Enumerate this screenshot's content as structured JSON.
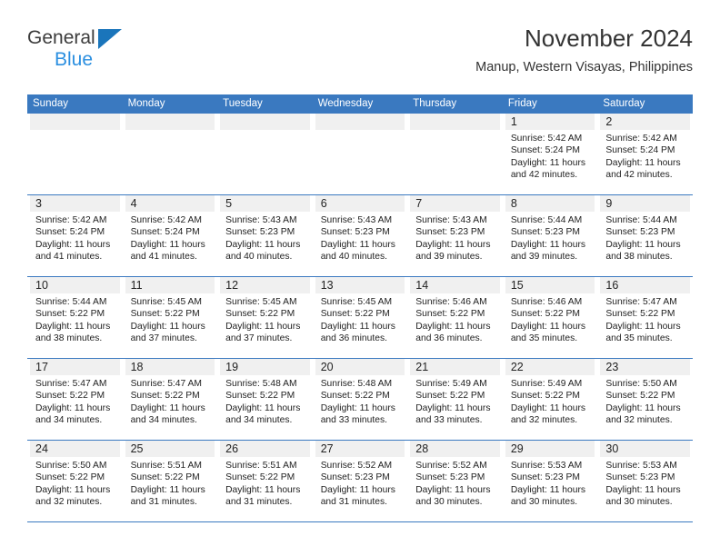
{
  "brand": {
    "name_top": "General",
    "name_bottom": "Blue",
    "color_dark": "#3c3c3c",
    "color_blue": "#2b8fe0",
    "triangle_color": "#1a75bb"
  },
  "header": {
    "title": "November 2024",
    "subtitle": "Manup, Western Visayas, Philippines",
    "accent_color": "#3a79c0",
    "daynum_bg": "#f0f0f0"
  },
  "weekday_headers": [
    "Sunday",
    "Monday",
    "Tuesday",
    "Wednesday",
    "Thursday",
    "Friday",
    "Saturday"
  ],
  "labels": {
    "sunrise_prefix": "Sunrise:",
    "sunset_prefix": "Sunset:",
    "daylight_prefix": "Daylight:"
  },
  "weeks": [
    [
      {
        "day": "",
        "empty": true
      },
      {
        "day": "",
        "empty": true
      },
      {
        "day": "",
        "empty": true
      },
      {
        "day": "",
        "empty": true
      },
      {
        "day": "",
        "empty": true
      },
      {
        "day": "1",
        "sunrise": "Sunrise: 5:42 AM",
        "sunset": "Sunset: 5:24 PM",
        "daylight_l1": "Daylight: 11 hours",
        "daylight_l2": "and 42 minutes."
      },
      {
        "day": "2",
        "sunrise": "Sunrise: 5:42 AM",
        "sunset": "Sunset: 5:24 PM",
        "daylight_l1": "Daylight: 11 hours",
        "daylight_l2": "and 42 minutes."
      }
    ],
    [
      {
        "day": "3",
        "sunrise": "Sunrise: 5:42 AM",
        "sunset": "Sunset: 5:24 PM",
        "daylight_l1": "Daylight: 11 hours",
        "daylight_l2": "and 41 minutes."
      },
      {
        "day": "4",
        "sunrise": "Sunrise: 5:42 AM",
        "sunset": "Sunset: 5:24 PM",
        "daylight_l1": "Daylight: 11 hours",
        "daylight_l2": "and 41 minutes."
      },
      {
        "day": "5",
        "sunrise": "Sunrise: 5:43 AM",
        "sunset": "Sunset: 5:23 PM",
        "daylight_l1": "Daylight: 11 hours",
        "daylight_l2": "and 40 minutes."
      },
      {
        "day": "6",
        "sunrise": "Sunrise: 5:43 AM",
        "sunset": "Sunset: 5:23 PM",
        "daylight_l1": "Daylight: 11 hours",
        "daylight_l2": "and 40 minutes."
      },
      {
        "day": "7",
        "sunrise": "Sunrise: 5:43 AM",
        "sunset": "Sunset: 5:23 PM",
        "daylight_l1": "Daylight: 11 hours",
        "daylight_l2": "and 39 minutes."
      },
      {
        "day": "8",
        "sunrise": "Sunrise: 5:44 AM",
        "sunset": "Sunset: 5:23 PM",
        "daylight_l1": "Daylight: 11 hours",
        "daylight_l2": "and 39 minutes."
      },
      {
        "day": "9",
        "sunrise": "Sunrise: 5:44 AM",
        "sunset": "Sunset: 5:23 PM",
        "daylight_l1": "Daylight: 11 hours",
        "daylight_l2": "and 38 minutes."
      }
    ],
    [
      {
        "day": "10",
        "sunrise": "Sunrise: 5:44 AM",
        "sunset": "Sunset: 5:22 PM",
        "daylight_l1": "Daylight: 11 hours",
        "daylight_l2": "and 38 minutes."
      },
      {
        "day": "11",
        "sunrise": "Sunrise: 5:45 AM",
        "sunset": "Sunset: 5:22 PM",
        "daylight_l1": "Daylight: 11 hours",
        "daylight_l2": "and 37 minutes."
      },
      {
        "day": "12",
        "sunrise": "Sunrise: 5:45 AM",
        "sunset": "Sunset: 5:22 PM",
        "daylight_l1": "Daylight: 11 hours",
        "daylight_l2": "and 37 minutes."
      },
      {
        "day": "13",
        "sunrise": "Sunrise: 5:45 AM",
        "sunset": "Sunset: 5:22 PM",
        "daylight_l1": "Daylight: 11 hours",
        "daylight_l2": "and 36 minutes."
      },
      {
        "day": "14",
        "sunrise": "Sunrise: 5:46 AM",
        "sunset": "Sunset: 5:22 PM",
        "daylight_l1": "Daylight: 11 hours",
        "daylight_l2": "and 36 minutes."
      },
      {
        "day": "15",
        "sunrise": "Sunrise: 5:46 AM",
        "sunset": "Sunset: 5:22 PM",
        "daylight_l1": "Daylight: 11 hours",
        "daylight_l2": "and 35 minutes."
      },
      {
        "day": "16",
        "sunrise": "Sunrise: 5:47 AM",
        "sunset": "Sunset: 5:22 PM",
        "daylight_l1": "Daylight: 11 hours",
        "daylight_l2": "and 35 minutes."
      }
    ],
    [
      {
        "day": "17",
        "sunrise": "Sunrise: 5:47 AM",
        "sunset": "Sunset: 5:22 PM",
        "daylight_l1": "Daylight: 11 hours",
        "daylight_l2": "and 34 minutes."
      },
      {
        "day": "18",
        "sunrise": "Sunrise: 5:47 AM",
        "sunset": "Sunset: 5:22 PM",
        "daylight_l1": "Daylight: 11 hours",
        "daylight_l2": "and 34 minutes."
      },
      {
        "day": "19",
        "sunrise": "Sunrise: 5:48 AM",
        "sunset": "Sunset: 5:22 PM",
        "daylight_l1": "Daylight: 11 hours",
        "daylight_l2": "and 34 minutes."
      },
      {
        "day": "20",
        "sunrise": "Sunrise: 5:48 AM",
        "sunset": "Sunset: 5:22 PM",
        "daylight_l1": "Daylight: 11 hours",
        "daylight_l2": "and 33 minutes."
      },
      {
        "day": "21",
        "sunrise": "Sunrise: 5:49 AM",
        "sunset": "Sunset: 5:22 PM",
        "daylight_l1": "Daylight: 11 hours",
        "daylight_l2": "and 33 minutes."
      },
      {
        "day": "22",
        "sunrise": "Sunrise: 5:49 AM",
        "sunset": "Sunset: 5:22 PM",
        "daylight_l1": "Daylight: 11 hours",
        "daylight_l2": "and 32 minutes."
      },
      {
        "day": "23",
        "sunrise": "Sunrise: 5:50 AM",
        "sunset": "Sunset: 5:22 PM",
        "daylight_l1": "Daylight: 11 hours",
        "daylight_l2": "and 32 minutes."
      }
    ],
    [
      {
        "day": "24",
        "sunrise": "Sunrise: 5:50 AM",
        "sunset": "Sunset: 5:22 PM",
        "daylight_l1": "Daylight: 11 hours",
        "daylight_l2": "and 32 minutes."
      },
      {
        "day": "25",
        "sunrise": "Sunrise: 5:51 AM",
        "sunset": "Sunset: 5:22 PM",
        "daylight_l1": "Daylight: 11 hours",
        "daylight_l2": "and 31 minutes."
      },
      {
        "day": "26",
        "sunrise": "Sunrise: 5:51 AM",
        "sunset": "Sunset: 5:22 PM",
        "daylight_l1": "Daylight: 11 hours",
        "daylight_l2": "and 31 minutes."
      },
      {
        "day": "27",
        "sunrise": "Sunrise: 5:52 AM",
        "sunset": "Sunset: 5:23 PM",
        "daylight_l1": "Daylight: 11 hours",
        "daylight_l2": "and 31 minutes."
      },
      {
        "day": "28",
        "sunrise": "Sunrise: 5:52 AM",
        "sunset": "Sunset: 5:23 PM",
        "daylight_l1": "Daylight: 11 hours",
        "daylight_l2": "and 30 minutes."
      },
      {
        "day": "29",
        "sunrise": "Sunrise: 5:53 AM",
        "sunset": "Sunset: 5:23 PM",
        "daylight_l1": "Daylight: 11 hours",
        "daylight_l2": "and 30 minutes."
      },
      {
        "day": "30",
        "sunrise": "Sunrise: 5:53 AM",
        "sunset": "Sunset: 5:23 PM",
        "daylight_l1": "Daylight: 11 hours",
        "daylight_l2": "and 30 minutes."
      }
    ]
  ]
}
